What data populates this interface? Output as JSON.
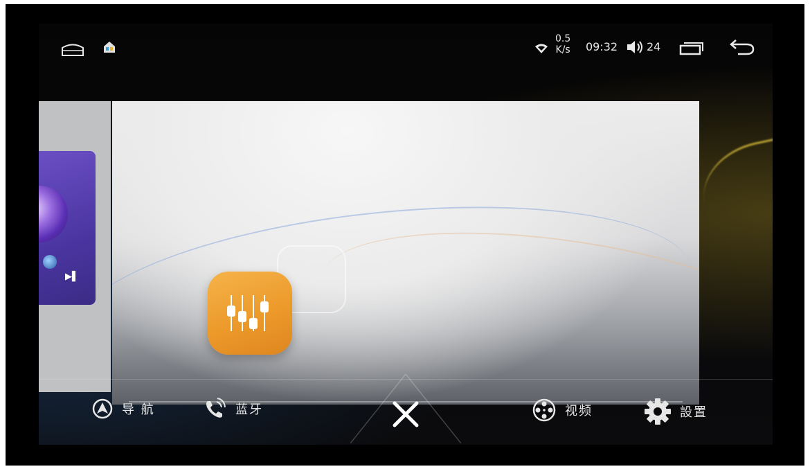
{
  "status_bar": {
    "net_speed_value": "0.5",
    "net_speed_unit": "K/s",
    "time": "09:32",
    "volume_level": "24"
  },
  "dock": {
    "nav_label": "导 航",
    "bluetooth_label": "蓝牙",
    "video_label": "视频",
    "settings_label": "設置"
  },
  "colors": {
    "app_icon_orange": "#ec9a2a",
    "music_widget_purple": "#5b3fb5",
    "background": "#000000"
  },
  "icons": {
    "home": "home-outline-icon",
    "app": "home-app-icon",
    "wifi": "wifi-icon",
    "volume": "volume-icon",
    "recents": "recents-icon",
    "back": "back-arrow-icon",
    "equalizer": "equalizer-icon",
    "close": "close-x-icon",
    "navigation": "navigation-arrow-icon",
    "bluetooth_phone": "bluetooth-phone-icon",
    "video": "film-reel-icon",
    "settings": "gear-icon",
    "next_track": "next-track-icon"
  }
}
